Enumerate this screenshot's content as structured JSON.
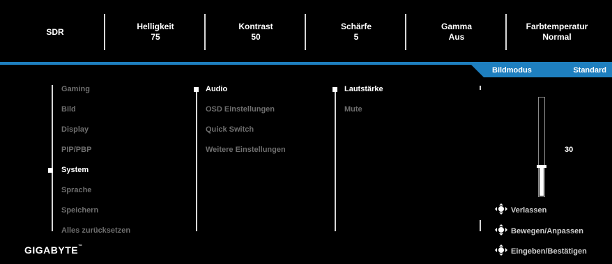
{
  "header": {
    "stats": [
      {
        "label": "SDR",
        "value": ""
      },
      {
        "label": "Helligkeit",
        "value": "75"
      },
      {
        "label": "Kontrast",
        "value": "50"
      },
      {
        "label": "Schärfe",
        "value": "5"
      },
      {
        "label": "Gamma",
        "value": "Aus"
      },
      {
        "label": "Farbtemperatur",
        "value": "Normal"
      }
    ]
  },
  "mode": {
    "label": "Bildmodus",
    "value": "Standard"
  },
  "menu": {
    "main": [
      "Gaming",
      "Bild",
      "Display",
      "PIP/PBP",
      "System",
      "Sprache",
      "Speichern",
      "Alles zurücksetzen"
    ],
    "main_active": "System",
    "sub": [
      "Audio",
      "OSD Einstellungen",
      "Quick Switch",
      "Weitere Einstellungen"
    ],
    "sub_active": "Audio",
    "third": [
      "Lautstärke",
      "Mute"
    ],
    "third_active": "Lautstärke"
  },
  "slider": {
    "value": "30",
    "level_percent": 30
  },
  "hints": [
    {
      "icon": "joystick-left-icon",
      "label": "Verlassen"
    },
    {
      "icon": "joystick-move-icon",
      "label": "Bewegen/Anpassen"
    },
    {
      "icon": "joystick-press-icon",
      "label": "Eingeben/Bestätigen"
    }
  ],
  "brand": {
    "name": "GIGABYTE",
    "mark": "™"
  },
  "colors": {
    "accent": "#1e7fbf",
    "inactive_text": "#6f6f6f",
    "background": "#000000"
  }
}
